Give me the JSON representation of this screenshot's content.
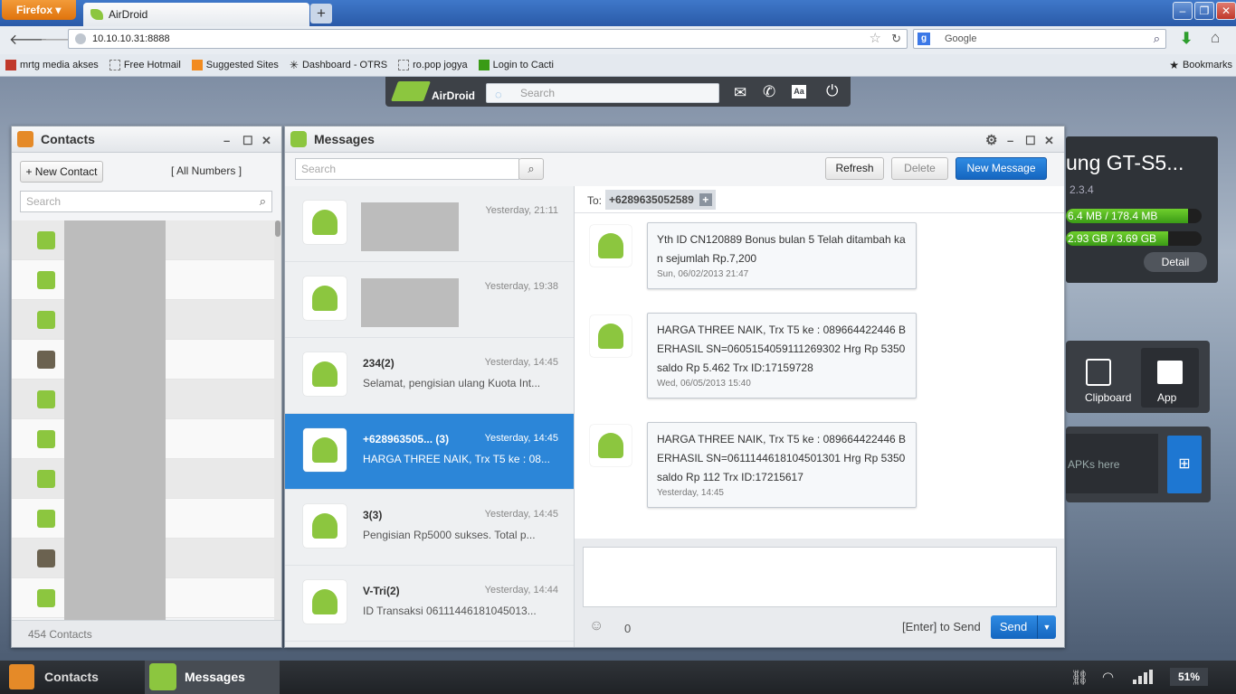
{
  "browser": {
    "menu": "Firefox",
    "tab_title": "AirDroid",
    "url": "10.10.10.31:8888",
    "search_placeholder": "Google",
    "bookmarks_label": "Bookmarks"
  },
  "bookmarks": [
    "mrtg media akses",
    "Free Hotmail",
    "Suggested Sites",
    "Dashboard - OTRS",
    "ro.pop jogya",
    "Login to Cacti"
  ],
  "airdroid": {
    "logo": "AirDroid",
    "search_placeholder": "Search"
  },
  "contacts": {
    "title": "Contacts",
    "new_contact": "+ New Contact",
    "all_numbers": "[ All Numbers ]",
    "search_placeholder": "Search",
    "count": "454 Contacts"
  },
  "messages": {
    "title": "Messages",
    "search_placeholder": "Search",
    "refresh": "Refresh",
    "delete": "Delete",
    "new_message": "New Message",
    "to_label": "To:",
    "to_number": "+6289635052589",
    "counter": "0",
    "enter_hint": "[Enter] to Send",
    "send": "Send",
    "threads": [
      {
        "name": "",
        "time": "Yesterday, 21:11",
        "preview": ""
      },
      {
        "name": "",
        "time": "Yesterday, 19:38",
        "preview": ""
      },
      {
        "name": "234(2)",
        "time": "Yesterday, 14:45",
        "preview": "Selamat, pengisian ulang Kuota Int..."
      },
      {
        "name": "+628963505... (3)",
        "time": "Yesterday, 14:45",
        "preview": "HARGA THREE NAIK, Trx T5 ke : 08..."
      },
      {
        "name": "3(3)",
        "time": "Yesterday, 14:45",
        "preview": "Pengisian Rp5000 sukses. Total p..."
      },
      {
        "name": "V-Tri(2)",
        "time": "Yesterday, 14:44",
        "preview": "ID Transaksi 06111446181045013..."
      }
    ],
    "conversation": [
      {
        "text": "Yth ID CN120889 Bonus bulan 5 Telah ditambah kan sejumlah Rp.7,200",
        "date": "Sun, 06/02/2013 21:47"
      },
      {
        "text": "HARGA THREE NAIK, Trx T5 ke : 089664422446 BERHASIL SN=0605154059111269302 Hrg Rp 5350 saldo Rp 5.462 Trx ID:17159728",
        "date": "Wed, 06/05/2013 15:40"
      },
      {
        "text": "HARGA THREE NAIK, Trx T5 ke : 089664422446 BERHASIL SN=0611144618104501301 Hrg Rp 5350 saldo Rp 112 Trx ID:17215617",
        "date": "Yesterday, 14:45"
      }
    ]
  },
  "device": {
    "model": "ung GT-S5...",
    "version": "2.3.4",
    "ram": "6.4 MB / 178.4 MB",
    "storage": "2.93 GB / 3.69 GB",
    "detail": "Detail",
    "ram_fill": 0.9,
    "storage_fill": 0.75
  },
  "tools": {
    "clipboard": "Clipboard",
    "app": "App",
    "apk_hint": "APKs here"
  },
  "taskbar": {
    "contacts": "Contacts",
    "messages": "Messages",
    "battery": "51%"
  },
  "colors": {
    "accent": "#1e77d2",
    "selected": "#2c86d8",
    "android_green": "#8cc63f"
  }
}
